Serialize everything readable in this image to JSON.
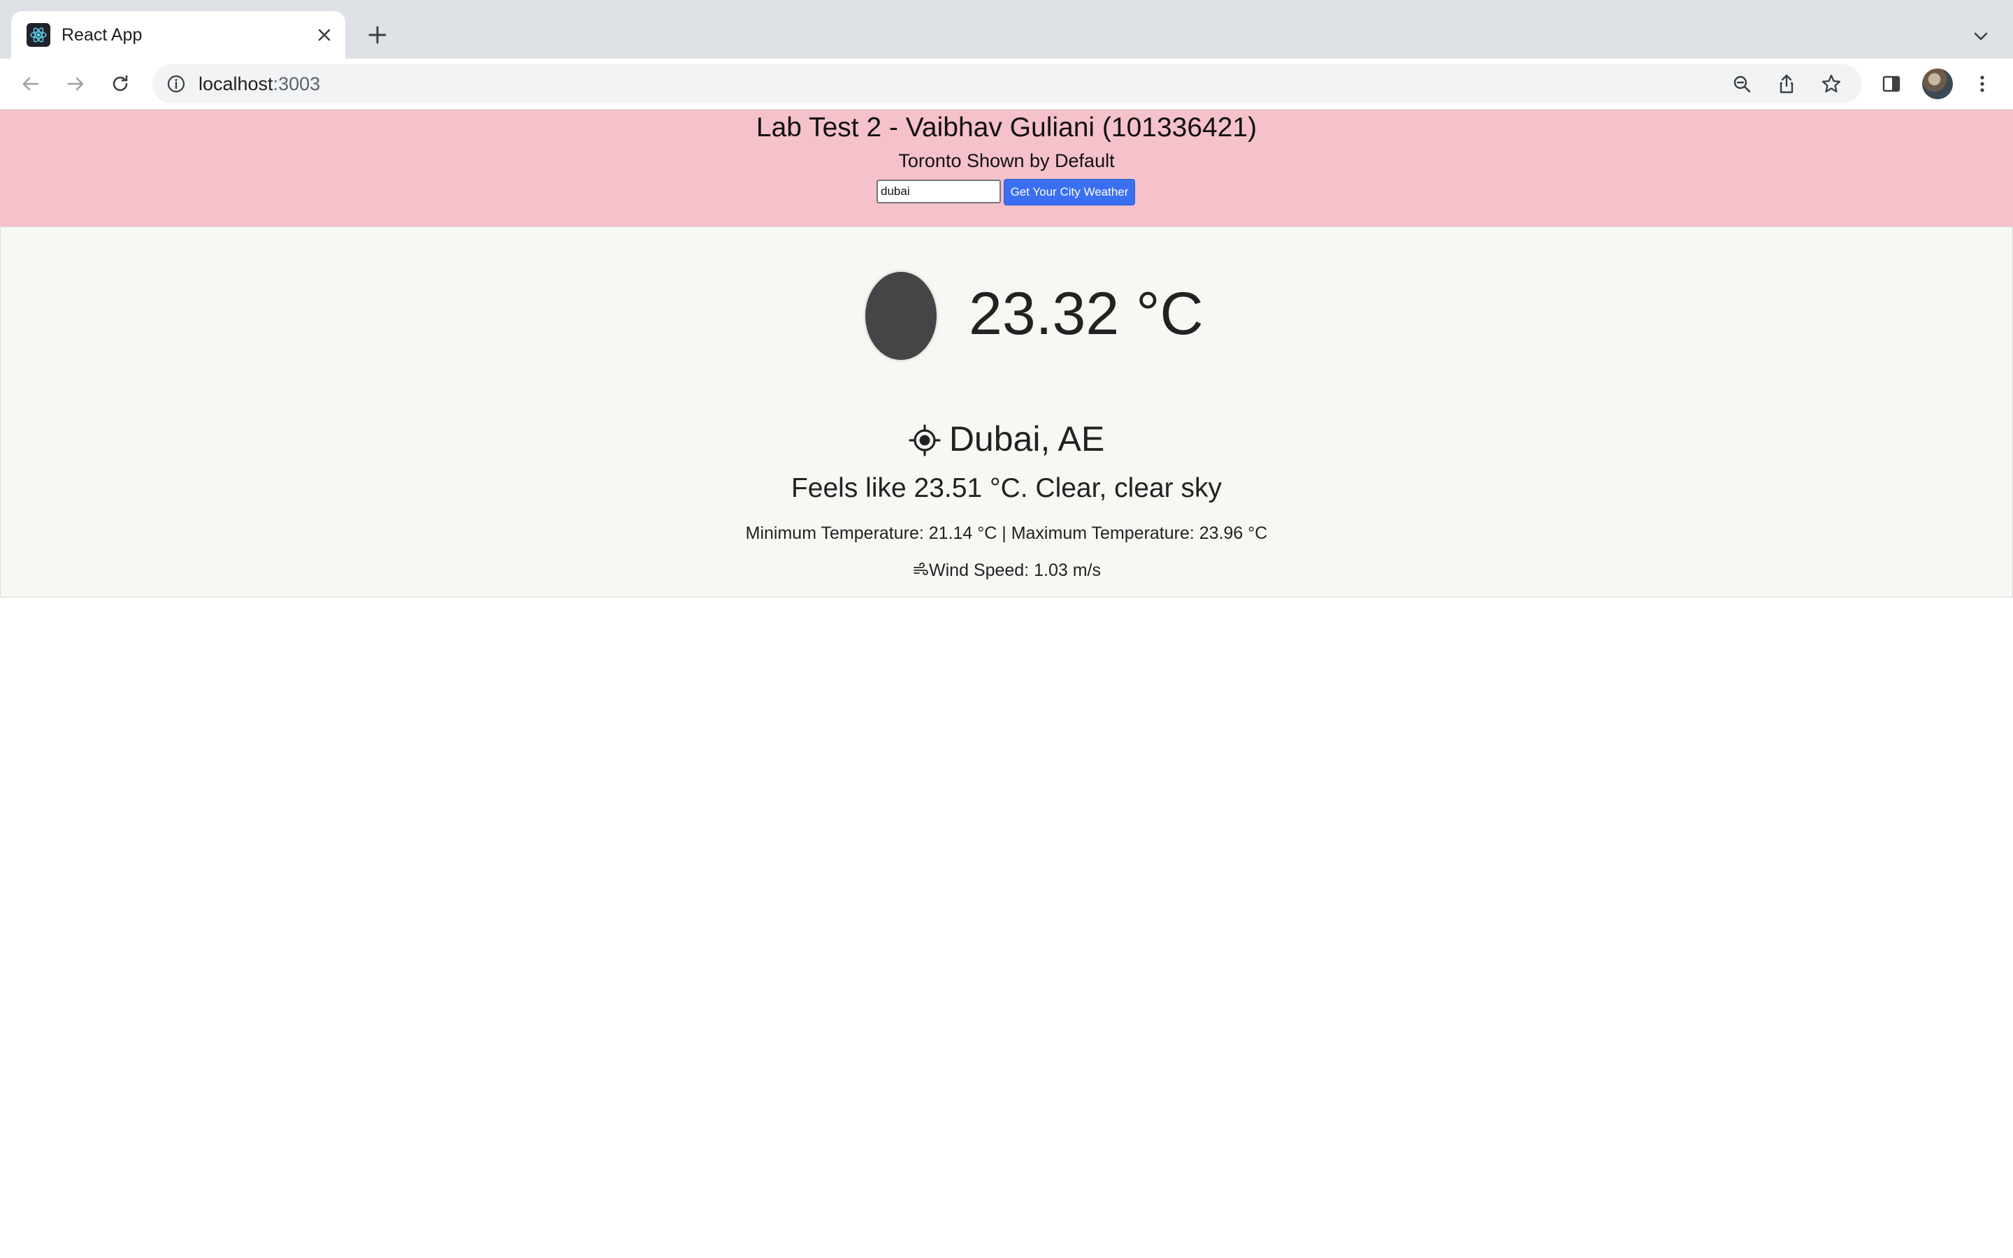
{
  "browser": {
    "tab": {
      "title": "React App",
      "favicon": "react-logo-icon"
    },
    "address": {
      "host": "localhost",
      "port": ":3003"
    },
    "icons": {
      "back": "back-arrow-icon",
      "forward": "forward-arrow-icon",
      "reload": "reload-icon",
      "info": "site-info-icon",
      "zoom": "zoom-out-icon",
      "share": "share-icon",
      "bookmark": "star-icon",
      "sidepanel": "side-panel-icon",
      "menu": "kebab-menu-icon"
    }
  },
  "header": {
    "title": "Lab Test 2 - Vaibhav Guliani (101336421)",
    "subtitle": "Toronto Shown by Default",
    "search": {
      "value": "dubai",
      "button_label": "Get Your City Weather"
    },
    "background_color": "#f5c1cb"
  },
  "weather": {
    "temperature": "23.32 °C",
    "location": "Dubai, AE",
    "feels_like": "Feels like 23.51 °C. Clear, clear sky",
    "min_max": "Minimum Temperature: 21.14 °C | Maximum Temperature: 23.96 °C",
    "wind": "Wind Speed: 1.03 m/s",
    "button_color": "#3a6ff2"
  }
}
